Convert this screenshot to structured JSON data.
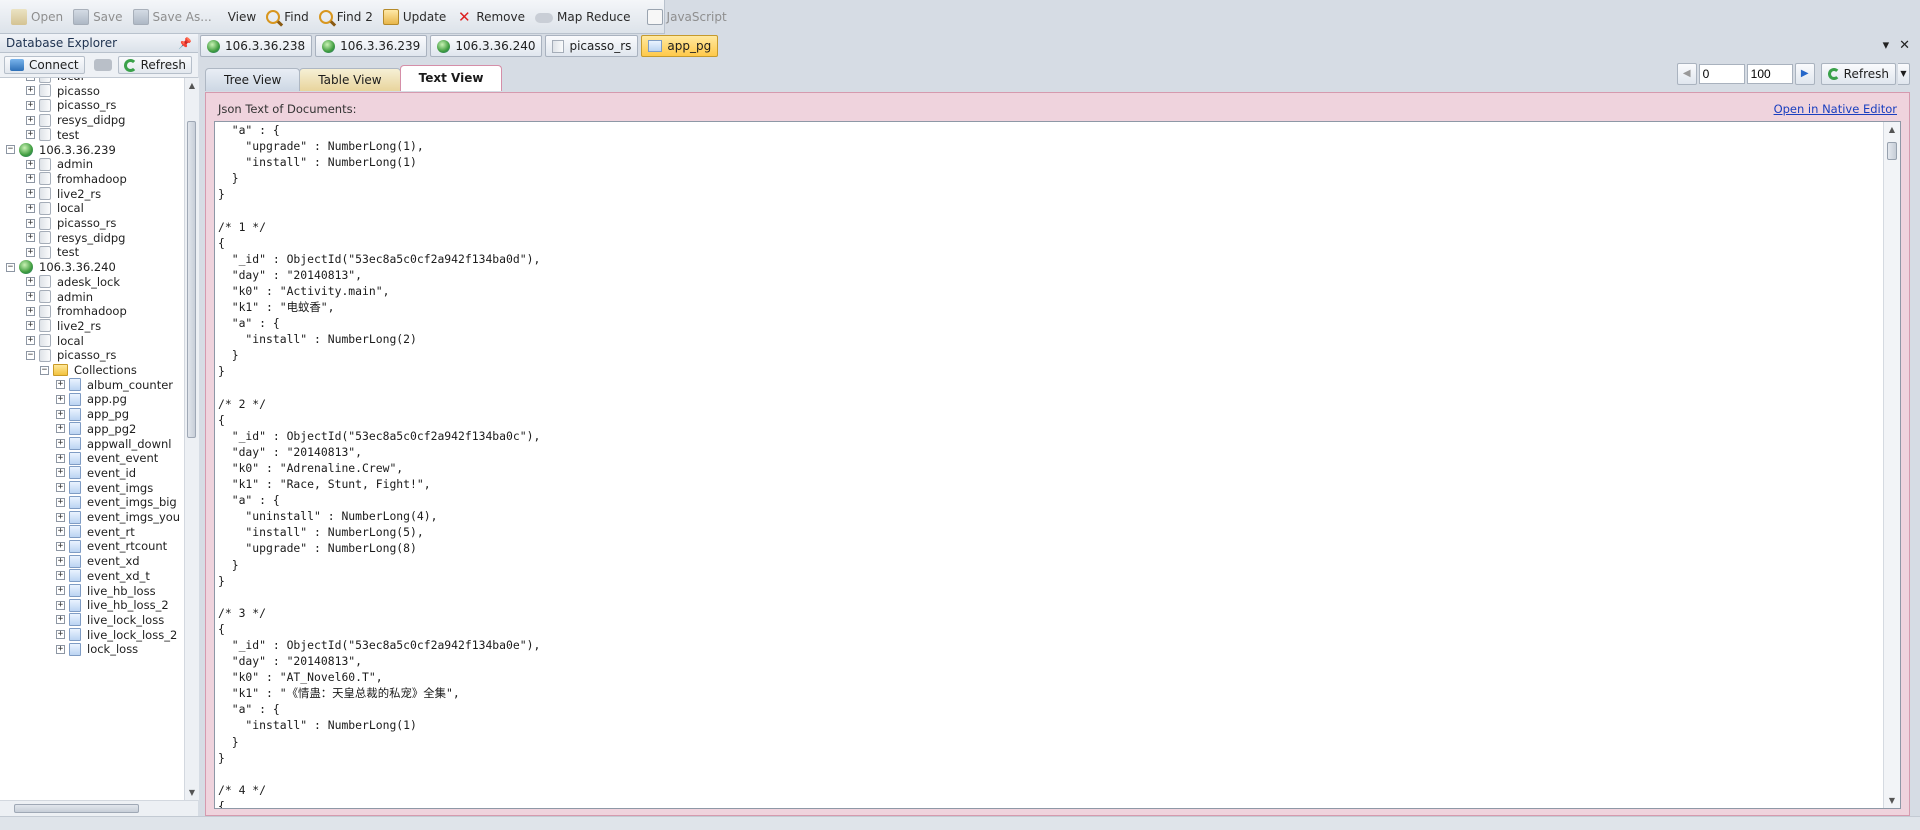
{
  "toolbar": {
    "open": "Open",
    "save": "Save",
    "save_as": "Save As...",
    "view": "View",
    "find": "Find",
    "find2": "Find 2",
    "update": "Update",
    "remove": "Remove",
    "map_reduce": "Map Reduce",
    "javascript": "JavaScript"
  },
  "explorer": {
    "title": "Database Explorer",
    "connect": "Connect",
    "refresh": "Refresh",
    "rows": [
      {
        "label": "local",
        "kind": "db",
        "level": 1
      },
      {
        "label": "picasso",
        "kind": "db",
        "level": 1
      },
      {
        "label": "picasso_rs",
        "kind": "db",
        "level": 1
      },
      {
        "label": "resys_didpg",
        "kind": "db",
        "level": 1
      },
      {
        "label": "test",
        "kind": "db",
        "level": 1
      },
      {
        "label": "106.3.36.239",
        "kind": "server",
        "level": 0
      },
      {
        "label": "admin",
        "kind": "db",
        "level": 1
      },
      {
        "label": "fromhadoop",
        "kind": "db",
        "level": 1
      },
      {
        "label": "live2_rs",
        "kind": "db",
        "level": 1
      },
      {
        "label": "local",
        "kind": "db",
        "level": 1
      },
      {
        "label": "picasso_rs",
        "kind": "db",
        "level": 1
      },
      {
        "label": "resys_didpg",
        "kind": "db",
        "level": 1
      },
      {
        "label": "test",
        "kind": "db",
        "level": 1
      },
      {
        "label": "106.3.36.240",
        "kind": "server",
        "level": 0
      },
      {
        "label": "adesk_lock",
        "kind": "db",
        "level": 1
      },
      {
        "label": "admin",
        "kind": "db",
        "level": 1
      },
      {
        "label": "fromhadoop",
        "kind": "db",
        "level": 1
      },
      {
        "label": "live2_rs",
        "kind": "db",
        "level": 1
      },
      {
        "label": "local",
        "kind": "db",
        "level": 1
      },
      {
        "label": "picasso_rs",
        "kind": "db",
        "level": 1,
        "expanded": true
      },
      {
        "label": "Collections",
        "kind": "folder",
        "level": 2,
        "expanded": true
      },
      {
        "label": "album_counter",
        "kind": "coll",
        "level": 3
      },
      {
        "label": "app.pg",
        "kind": "coll",
        "level": 3
      },
      {
        "label": "app_pg",
        "kind": "coll",
        "level": 3
      },
      {
        "label": "app_pg2",
        "kind": "coll",
        "level": 3
      },
      {
        "label": "appwall_downl",
        "kind": "coll",
        "level": 3
      },
      {
        "label": "event_event",
        "kind": "coll",
        "level": 3
      },
      {
        "label": "event_id",
        "kind": "coll",
        "level": 3
      },
      {
        "label": "event_imgs",
        "kind": "coll",
        "level": 3
      },
      {
        "label": "event_imgs_big",
        "kind": "coll",
        "level": 3
      },
      {
        "label": "event_imgs_you",
        "kind": "coll",
        "level": 3
      },
      {
        "label": "event_rt",
        "kind": "coll",
        "level": 3
      },
      {
        "label": "event_rtcount",
        "kind": "coll",
        "level": 3
      },
      {
        "label": "event_xd",
        "kind": "coll",
        "level": 3
      },
      {
        "label": "event_xd_t",
        "kind": "coll",
        "level": 3
      },
      {
        "label": "live_hb_loss",
        "kind": "coll",
        "level": 3
      },
      {
        "label": "live_hb_loss_2",
        "kind": "coll",
        "level": 3
      },
      {
        "label": "live_lock_loss",
        "kind": "coll",
        "level": 3
      },
      {
        "label": "live_lock_loss_2",
        "kind": "coll",
        "level": 3
      },
      {
        "label": "lock_loss",
        "kind": "coll",
        "level": 3
      }
    ]
  },
  "doc_tabs": [
    {
      "label": "106.3.36.238",
      "kind": "server"
    },
    {
      "label": "106.3.36.239",
      "kind": "server"
    },
    {
      "label": "106.3.36.240",
      "kind": "server"
    },
    {
      "label": "picasso_rs",
      "kind": "db"
    },
    {
      "label": "app_pg",
      "kind": "coll",
      "active": true
    }
  ],
  "view_tabs": {
    "tree": "Tree View",
    "table": "Table View",
    "text": "Text View"
  },
  "paging": {
    "skip": "0",
    "limit": "100",
    "refresh": "Refresh"
  },
  "panel": {
    "label": "Json Text of Documents:",
    "native_link": "Open in Native Editor",
    "text": "  \"a\" : {\n    \"upgrade\" : NumberLong(1),\n    \"install\" : NumberLong(1)\n  }\n}\n\n/* 1 */\n{\n  \"_id\" : ObjectId(\"53ec8a5c0cf2a942f134ba0d\"),\n  \"day\" : \"20140813\",\n  \"k0\" : \"Activity.main\",\n  \"k1\" : \"电蚊香\",\n  \"a\" : {\n    \"install\" : NumberLong(2)\n  }\n}\n\n/* 2 */\n{\n  \"_id\" : ObjectId(\"53ec8a5c0cf2a942f134ba0c\"),\n  \"day\" : \"20140813\",\n  \"k0\" : \"Adrenaline.Crew\",\n  \"k1\" : \"Race, Stunt, Fight!\",\n  \"a\" : {\n    \"uninstall\" : NumberLong(4),\n    \"install\" : NumberLong(5),\n    \"upgrade\" : NumberLong(8)\n  }\n}\n\n/* 3 */\n{\n  \"_id\" : ObjectId(\"53ec8a5c0cf2a942f134ba0e\"),\n  \"day\" : \"20140813\",\n  \"k0\" : \"AT_Novel60.T\",\n  \"k1\" : \"《情蛊：天皇总裁的私宠》全集\",\n  \"a\" : {\n    \"install\" : NumberLong(1)\n  }\n}\n\n/* 4 */\n{"
  }
}
